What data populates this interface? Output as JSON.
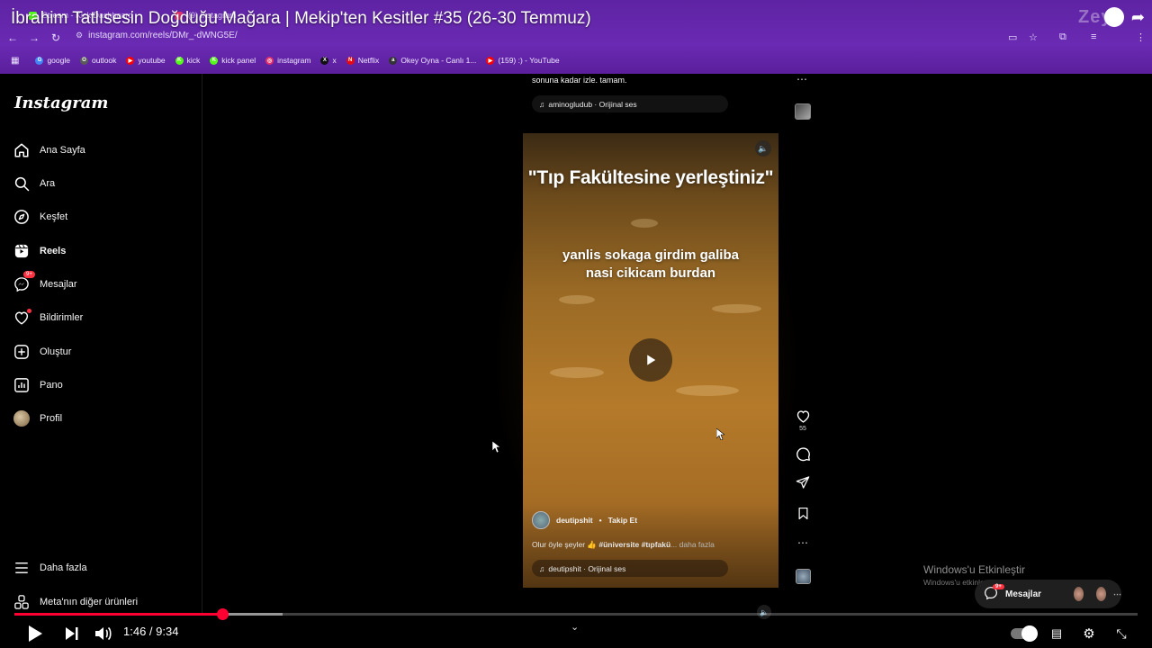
{
  "browser": {
    "tabs": [
      {
        "label": "Stream - Kick Dashboard",
        "color": "#53fc18"
      },
      {
        "label": "(9) Instagram",
        "color": "#e1306c"
      }
    ],
    "url": "instagram.com/reels/DMr_-dWNG5E/",
    "bookmarks": [
      {
        "label": "google",
        "icon": "google-icon",
        "color": "#4285f4",
        "glyph": "G"
      },
      {
        "label": "outlook",
        "icon": "outlook-icon",
        "color": "#5a5a5a",
        "glyph": "O"
      },
      {
        "label": "youtube",
        "icon": "youtube-icon",
        "color": "#ff0000",
        "glyph": "▶"
      },
      {
        "label": "kick",
        "icon": "kick-icon",
        "color": "#53fc18",
        "glyph": "K"
      },
      {
        "label": "kick panel",
        "icon": "kick-icon",
        "color": "#53fc18",
        "glyph": "K"
      },
      {
        "label": "instagram",
        "icon": "instagram-icon",
        "color": "#e1306c",
        "glyph": "◎"
      },
      {
        "label": "x",
        "icon": "x-icon",
        "color": "#111111",
        "glyph": "X"
      },
      {
        "label": "Netflix",
        "icon": "netflix-icon",
        "color": "#e50914",
        "glyph": "N"
      },
      {
        "label": "Okey Oyna - Canlı 1...",
        "icon": "okey-icon",
        "color": "#333333",
        "glyph": "a"
      },
      {
        "label": "(159) :) - YouTube",
        "icon": "youtube-icon",
        "color": "#ff0000",
        "glyph": "▶"
      }
    ]
  },
  "video_title": "İbrahim Tatlısesin Doğduğu Mağara | Mekip'ten Kesitler #35 (26-30 Temmuz)",
  "watermark": "Zeyn",
  "sidebar": {
    "logo": "Instagram",
    "items": [
      {
        "label": "Ana Sayfa",
        "icon": "home-icon"
      },
      {
        "label": "Ara",
        "icon": "search-icon"
      },
      {
        "label": "Keşfet",
        "icon": "compass-icon"
      },
      {
        "label": "Reels",
        "icon": "reels-icon"
      },
      {
        "label": "Mesajlar",
        "icon": "messenger-icon",
        "badge": "9+"
      },
      {
        "label": "Bildirimler",
        "icon": "heart-icon"
      },
      {
        "label": "Oluştur",
        "icon": "plus-square-icon"
      },
      {
        "label": "Pano",
        "icon": "dashboard-icon"
      },
      {
        "label": "Profil",
        "icon": "avatar"
      }
    ],
    "more": "Daha fazla",
    "meta": "Meta'nın diğer ürünleri"
  },
  "feed": {
    "caption_top": "sonuna kadar izle. tamam.",
    "audio_top": "aminogludub · Orijinal ses"
  },
  "reel": {
    "headline": "\"Tıp Fakültesine yerleştiniz\"",
    "subtitle_line1": "yanlis sokaga girdim galiba",
    "subtitle_line2": "nasi cikicam burdan",
    "author": "deutipshit",
    "separator": "•",
    "follow": "Takip Et",
    "caption_text": "Olur öyle şeyler 👍 ",
    "caption_tags": "#üniversite #tıpfakü",
    "caption_more": "... daha fazla",
    "audio": "deutipshit · Orijinal ses",
    "likes": "55"
  },
  "windows": {
    "title": "Windows'u Etkinleştir",
    "subtitle": "Windows'u etkinleştirmek için Ayarlar'a gidin."
  },
  "messages_pill": {
    "label": "Mesajlar",
    "badge": "9+"
  },
  "player": {
    "current_time": "1:46",
    "duration": "9:34",
    "time_separator": " / ",
    "played_fraction": 0.185,
    "buffered_fraction": 0.239,
    "accent": "#ff0033"
  },
  "colors": {
    "chrome": "#5e23a3",
    "ig_red": "#ff3040"
  }
}
